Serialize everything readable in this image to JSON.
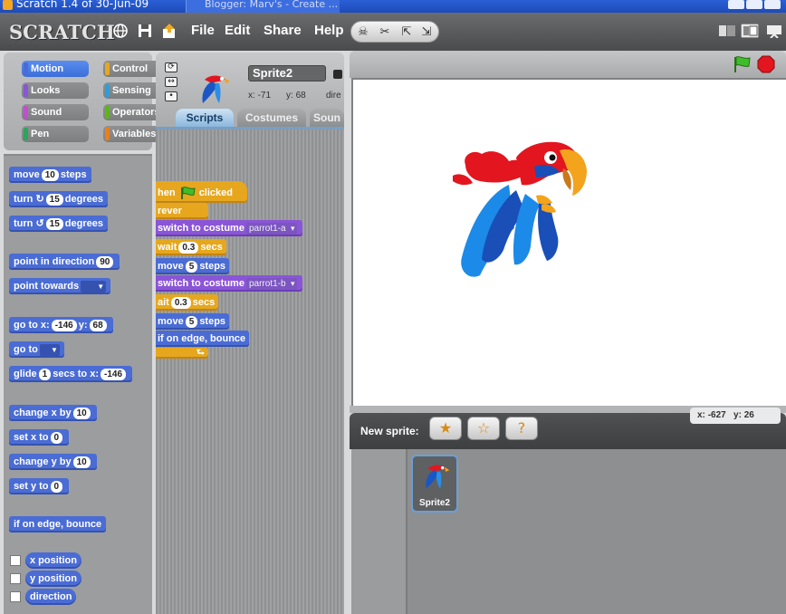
{
  "window": {
    "title": "Scratch 1.4 of 30-Jun-09",
    "taskbar_item": "Blogger: Marv's - Create ..."
  },
  "menubar": {
    "logo": "SCRATCH",
    "menus": [
      "File",
      "Edit",
      "Share",
      "Help"
    ],
    "icons": [
      "globe-icon",
      "save-icon",
      "upload-icon"
    ],
    "tools": [
      "stamp-icon",
      "scissors-icon",
      "grow-icon",
      "shrink-icon"
    ],
    "modes": [
      "small-stage-icon",
      "normal-stage-icon",
      "presentation-icon"
    ]
  },
  "categories": [
    "Motion",
    "Control",
    "Looks",
    "Sensing",
    "Sound",
    "Operators",
    "Pen",
    "Variables"
  ],
  "active_category": "Motion",
  "palette": {
    "move_label": "move",
    "move_val": "10",
    "move_end": "steps",
    "turn_cw_label": "turn",
    "turn_cw_val": "15",
    "turn_cw_end": "degrees",
    "turn_ccw_label": "turn",
    "turn_ccw_val": "15",
    "turn_ccw_end": "degrees",
    "point_dir_label": "point in direction",
    "point_dir_val": "90",
    "point_towards_label": "point towards",
    "goto_xy_label": "go to x:",
    "goto_x_val": "-146",
    "goto_y_label": "y:",
    "goto_y_val": "68",
    "goto_label": "go to",
    "glide_label": "glide",
    "glide_secs": "1",
    "glide_mid": "secs to x:",
    "glide_x_val": "-146",
    "change_x_label": "change x by",
    "change_x_val": "10",
    "set_x_label": "set x to",
    "set_x_val": "0",
    "change_y_label": "change y by",
    "change_y_val": "10",
    "set_y_label": "set y to",
    "set_y_val": "0",
    "bounce_label": "if on edge, bounce",
    "x_pos": "x position",
    "y_pos": "y position",
    "direction": "direction"
  },
  "sprite": {
    "name": "Sprite2",
    "x_label": "x:",
    "x_val": "-71",
    "y_label": "y:",
    "y_val": "68",
    "dir_label": "dire"
  },
  "tabs": [
    "Scripts",
    "Costumes",
    "Soun"
  ],
  "active_tab": "Scripts",
  "script": {
    "hat": "hen",
    "hat_end": "clicked",
    "forever": "rever",
    "switch1_label": "switch to costume",
    "switch1_val": "parrot1-a",
    "wait1_label": "wait",
    "wait1_val": "0.3",
    "wait1_end": "secs",
    "move1_label": "move",
    "move1_val": "5",
    "move1_end": "steps",
    "switch2_label": "switch to costume",
    "switch2_val": "parrot1-b",
    "wait2_label": "ait",
    "wait2_val": "0.3",
    "wait2_end": "secs",
    "move2_label": "move",
    "move2_val": "5",
    "move2_end": "steps",
    "bounce_label": "if on edge, bounce"
  },
  "stage_controls": {
    "go": "green-flag-icon",
    "stop": "stop-sign-icon"
  },
  "sprite_library": {
    "new_sprite_label": "New sprite:",
    "buttons": [
      "paint-new-sprite-icon",
      "choose-sprite-file-icon",
      "surprise-sprite-icon"
    ],
    "mouse_x_label": "x:",
    "mouse_x": "-627",
    "mouse_y_label": "y:",
    "mouse_y": "26",
    "sprites": [
      {
        "name": "Sprite2"
      }
    ]
  },
  "colors": {
    "motion": "#4a6cd4",
    "control": "#e6a71e",
    "looks": "#8a55d7",
    "sound": "#c04fcf",
    "pen": "#2aa65a",
    "operators": "#5cb712",
    "sensing": "#2c9fd9",
    "variables": "#ee7d16"
  }
}
